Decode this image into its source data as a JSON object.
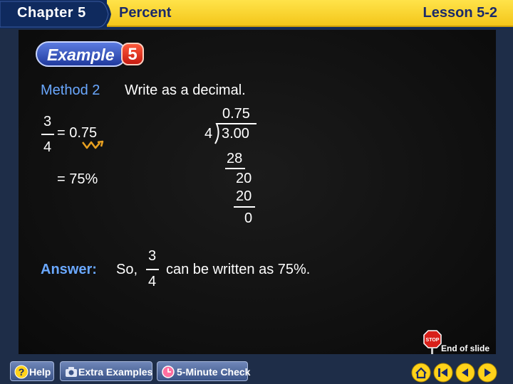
{
  "header": {
    "chapter": "Chapter 5",
    "section": "Percent",
    "lesson": "Lesson 5-2"
  },
  "example": {
    "label": "Example",
    "number": "5"
  },
  "method": {
    "label": "Method 2",
    "text": "Write as a decimal."
  },
  "work": {
    "frac_num": "3",
    "frac_den": "4",
    "eq_decimal": "= 0.75",
    "eq_percent": "= 75%"
  },
  "division": {
    "quotient": "0.75",
    "divisor": "4",
    "dividend": "3.00",
    "step1": "28",
    "step2": "20",
    "step3": "20",
    "remainder": "0"
  },
  "answer": {
    "label": "Answer:",
    "so": "So,",
    "frac_num": "3",
    "frac_den": "4",
    "rest": "can be written as 75%."
  },
  "footer": {
    "help": "Help",
    "extra_examples": "Extra Examples",
    "five_minute_check": "5-Minute Check",
    "end_of_slide": "End of slide"
  },
  "colors": {
    "accent_blue": "#6aa8ff",
    "header_yellow": "#ffe34a",
    "header_navy": "#0f2a5e"
  }
}
